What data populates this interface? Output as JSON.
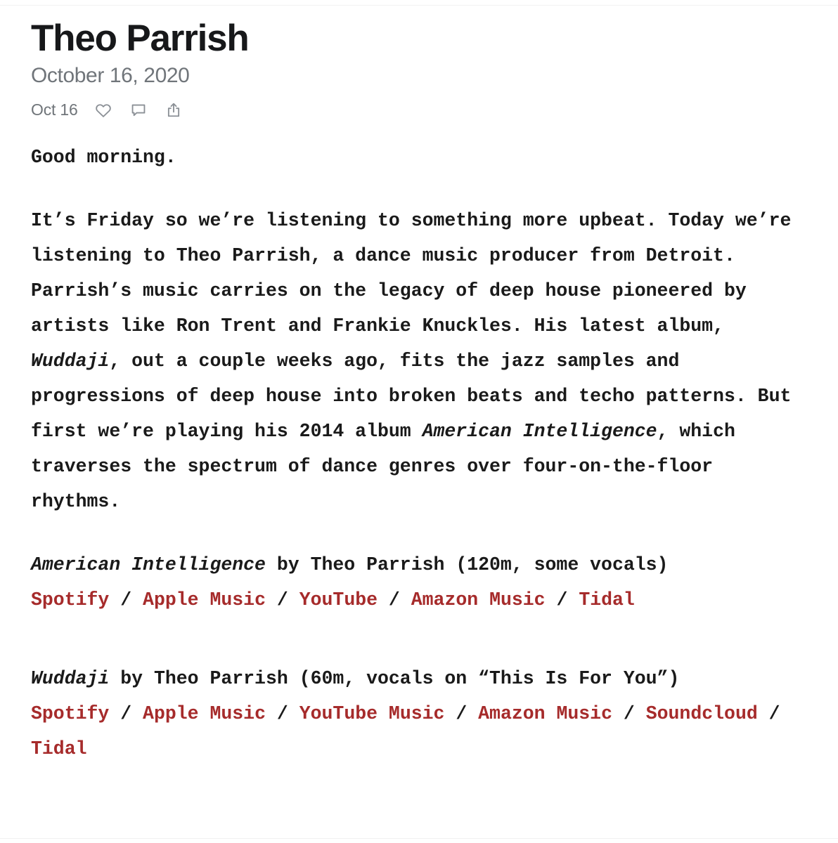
{
  "post": {
    "title": "Theo Parrish",
    "subtitle": "October 16, 2020",
    "meta_date": "Oct 16",
    "icons": {
      "like": "heart-icon",
      "comment": "comment-icon",
      "share": "share-icon"
    }
  },
  "body": {
    "greeting": "Good morning.",
    "paragraph_parts": {
      "p1_a": "It’s Friday so we’re listening to something more upbeat. Today we’re listening to Theo Parrish, a dance music producer from Detroit. Parrish’s music carries on the legacy of deep house pioneered by artists like Ron Trent and Frankie Knuckles. His latest album, ",
      "p1_italic_1": "Wuddaji",
      "p1_b": ", out a couple weeks ago, fits the jazz samples and progressions of deep house into broken beats and techo patterns. But first we’re playing his 2014 album ",
      "p1_italic_2": "American Intelligence",
      "p1_c": ", which traverses the spectrum of dance genres over four-on-the-floor rhythms."
    }
  },
  "albums": [
    {
      "title": "American Intelligence",
      "byline": " by Theo Parrish (120m, some vocals)",
      "links": [
        {
          "label": "Spotify"
        },
        {
          "label": "Apple Music"
        },
        {
          "label": "YouTube"
        },
        {
          "label": "Amazon Music"
        },
        {
          "label": "Tidal"
        }
      ]
    },
    {
      "title": "Wuddaji",
      "byline": " by Theo Parrish (60m, vocals on “This Is For You”)",
      "links": [
        {
          "label": "Spotify"
        },
        {
          "label": "Apple Music"
        },
        {
          "label": "YouTube Music"
        },
        {
          "label": "Amazon Music"
        },
        {
          "label": "Soundcloud"
        },
        {
          "label": "Tidal"
        }
      ]
    }
  ],
  "separator": "/",
  "colors": {
    "link_red": "#a62b2b",
    "title_black": "#17181a",
    "meta_gray": "#70757a",
    "body_black": "#1a1a1a",
    "icon_gray": "#8b9096"
  }
}
